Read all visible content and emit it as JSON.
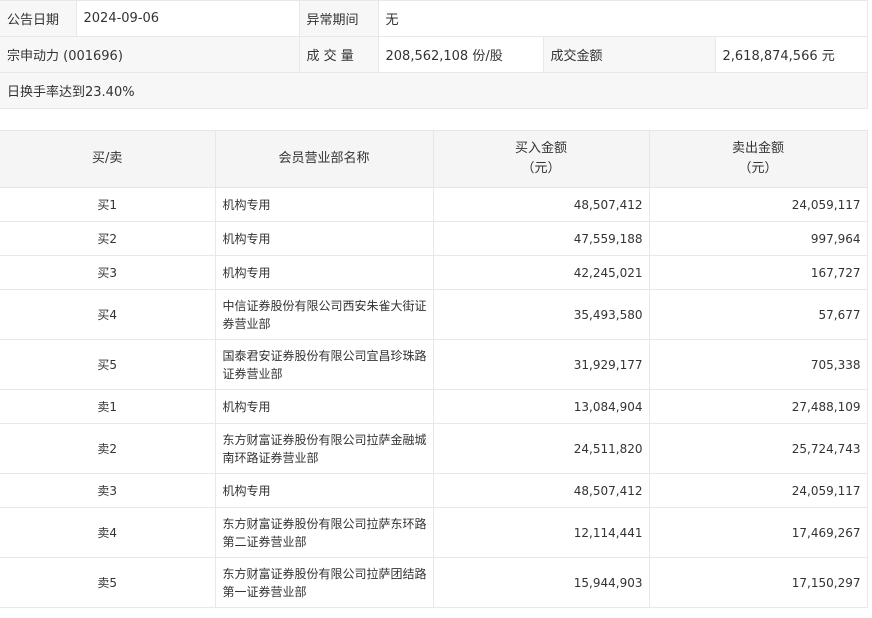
{
  "info": {
    "announce_date_label": "公告日期",
    "announce_date": "2024-09-06",
    "abnormal_period_label": "异常期间",
    "abnormal_period": "无",
    "stock_name": "宗申动力 (001696)",
    "volume_label": "成 交 量",
    "volume": "208,562,108 份/股",
    "amount_label": "成交金额",
    "amount": "2,618,874,566 元",
    "reason": "日换手率达到23.40%"
  },
  "table": {
    "headers": {
      "side": "买/卖",
      "branch": "会员营业部名称",
      "buy_line1": "买入金额",
      "buy_line2": "（元）",
      "sell_line1": "卖出金额",
      "sell_line2": "（元）"
    },
    "rows": [
      {
        "side": "买1",
        "branch_l1": "机构专用",
        "branch_l2": "",
        "buy": "48,507,412",
        "sell": "24,059,117"
      },
      {
        "side": "买2",
        "branch_l1": "机构专用",
        "branch_l2": "",
        "buy": "47,559,188",
        "sell": "997,964"
      },
      {
        "side": "买3",
        "branch_l1": "机构专用",
        "branch_l2": "",
        "buy": "42,245,021",
        "sell": "167,727"
      },
      {
        "side": "买4",
        "branch_l1": "中信证券股份有限公司西安朱雀大街证",
        "branch_l2": "券营业部",
        "buy": "35,493,580",
        "sell": "57,677"
      },
      {
        "side": "买5",
        "branch_l1": "国泰君安证券股份有限公司宜昌珍珠路",
        "branch_l2": "证券营业部",
        "buy": "31,929,177",
        "sell": "705,338"
      },
      {
        "side": "卖1",
        "branch_l1": "机构专用",
        "branch_l2": "",
        "buy": "13,084,904",
        "sell": "27,488,109"
      },
      {
        "side": "卖2",
        "branch_l1": "东方财富证券股份有限公司拉萨金融城",
        "branch_l2": "南环路证券营业部",
        "buy": "24,511,820",
        "sell": "25,724,743"
      },
      {
        "side": "卖3",
        "branch_l1": "机构专用",
        "branch_l2": "",
        "buy": "48,507,412",
        "sell": "24,059,117"
      },
      {
        "side": "卖4",
        "branch_l1": "东方财富证券股份有限公司拉萨东环路",
        "branch_l2": "第二证券营业部",
        "buy": "12,114,441",
        "sell": "17,469,267"
      },
      {
        "side": "卖5",
        "branch_l1": "东方财富证券股份有限公司拉萨团结路",
        "branch_l2": "第一证券营业部",
        "buy": "15,944,903",
        "sell": "17,150,297"
      }
    ]
  }
}
